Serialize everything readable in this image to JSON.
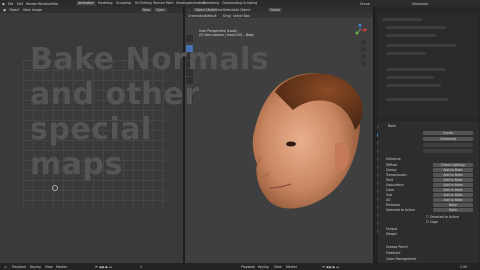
{
  "topbar": {
    "menus": [
      "File",
      "Edit",
      "Render",
      "Window",
      "Help"
    ],
    "tabs": [
      "Animation",
      "Modeling",
      "Sculpting",
      "UV Editing",
      "Texture Paint",
      "Shading",
      "Animation",
      "Rendering",
      "Compositing",
      "Scripting"
    ],
    "scene_label": "Scene",
    "view_layer_label": "ViewLayer"
  },
  "left_editor": {
    "mode": "Object",
    "view": "View",
    "image": "Image",
    "new": "New",
    "open": "Open"
  },
  "viewport": {
    "mode": "Object Mode",
    "view": "View",
    "select": "Select",
    "add": "Add",
    "object": "Object",
    "orientation": "Orientation",
    "default": "Default",
    "drag": "Drag",
    "select_box": "Select Box",
    "global": "Global",
    "info_line1": "User Perspective (Local)",
    "info_line2": "(0) Sam Lowres | mesh.001 - Body"
  },
  "overlay_title": [
    "Bake Normals",
    "and other",
    "special",
    "maps"
  ],
  "properties": {
    "header": "Bake",
    "render_engine_label": "Cycles",
    "bake_type": "Combined",
    "influence_label": "Influence",
    "influence_items": [
      {
        "name": "Diffuse",
        "btn": "Direct Lighting"
      },
      {
        "name": "Glossy",
        "btn": "Add to Bake"
      },
      {
        "name": "Transmission",
        "btn": "Add to Bake"
      },
      {
        "name": "Emit",
        "btn": "Add to Bake"
      },
      {
        "name": "Subsurface",
        "btn": "Add to Bake"
      },
      {
        "name": "Color",
        "btn": "Add to Bake"
      },
      {
        "name": "Sub",
        "btn": "Add to Bake"
      },
      {
        "name": "AO",
        "btn": "Add to Bake"
      },
      {
        "name": "Emission",
        "btn": "Bake"
      },
      {
        "name": "Selected to Active",
        "btn": "Bake"
      }
    ],
    "selected_to_active": "Selected to Active",
    "cage": "Cage",
    "output": "Output",
    "margin": "Margin",
    "bottom_items": [
      "Grease Pencil",
      "Freestyle",
      "Color Management"
    ]
  },
  "status": {
    "left": [
      "Playback",
      "Keying",
      "View",
      "Marker"
    ],
    "right": [
      "Playback",
      "Keying",
      "View",
      "Marker"
    ],
    "frame": "1",
    "version": "2.90"
  }
}
